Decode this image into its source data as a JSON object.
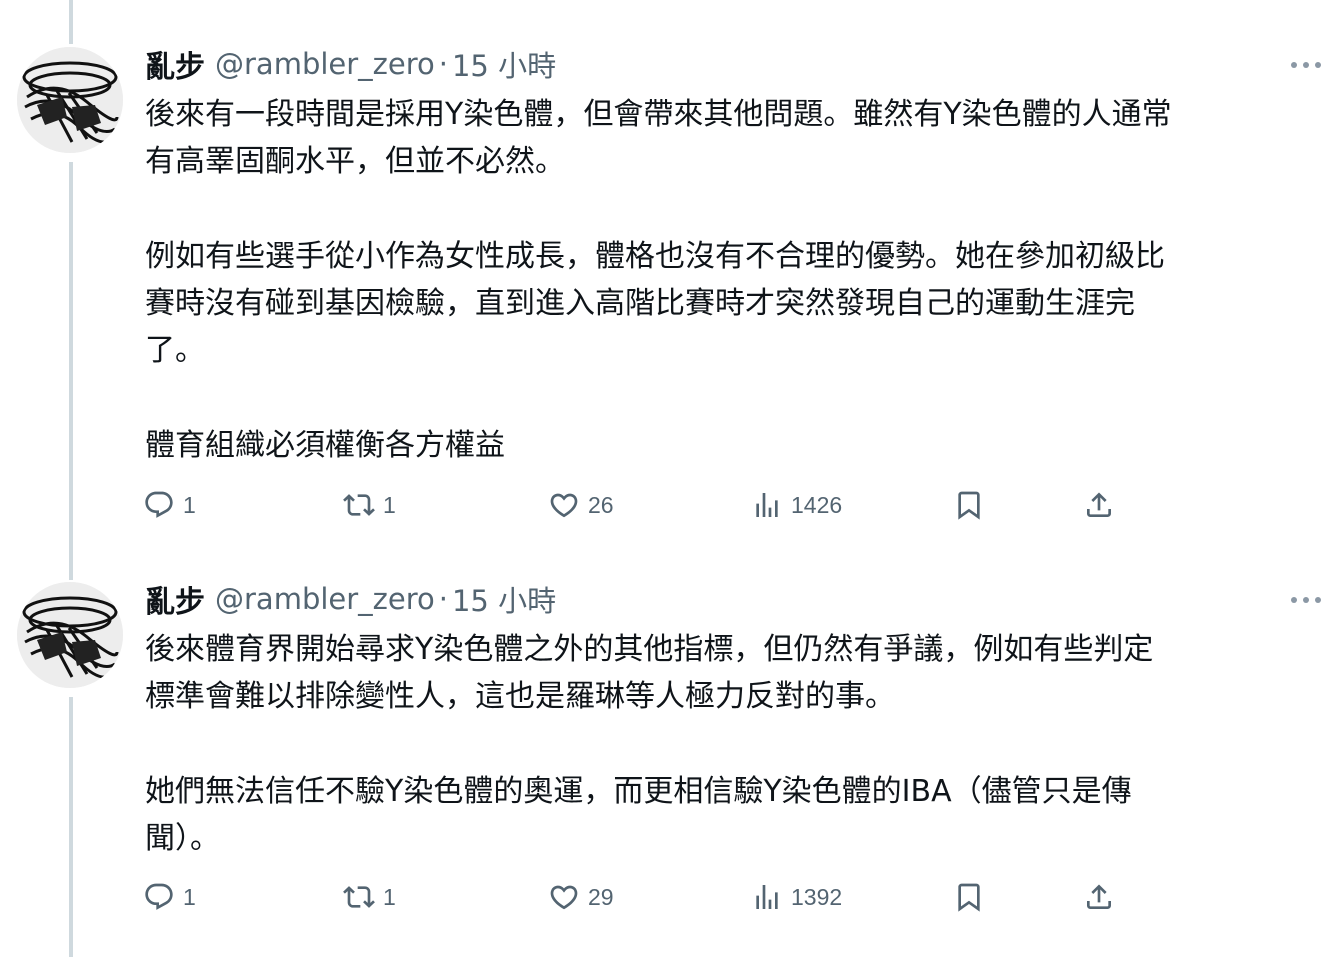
{
  "colors": {
    "text": "#0f1419",
    "secondary": "#536471",
    "thread_line": "#cfd9de"
  },
  "tweets": [
    {
      "name": "亂步",
      "handle": "@rambler_zero",
      "separator": "·",
      "time": "15 小時",
      "lines": [
        "後來有一段時間是採用Y染色體，但會帶來其他問題。雖然有Y染色體的人通常",
        "有高睪固酮水平，但並不必然。",
        "",
        "例如有些選手從小作為女性成長，體格也沒有不合理的優勢。她在參加初級比",
        "賽時沒有碰到基因檢驗，直到進入高階比賽時才突然發現自己的運動生涯完",
        "了。",
        "",
        "體育組織必須權衡各方權益"
      ],
      "replies": "1",
      "retweets": "1",
      "likes": "26",
      "views": "1426"
    },
    {
      "name": "亂步",
      "handle": "@rambler_zero",
      "separator": "·",
      "time": "15 小時",
      "lines": [
        "後來體育界開始尋求Y染色體之外的其他指標，但仍然有爭議，例如有些判定",
        "標準會難以排除變性人，這也是羅琳等人極力反對的事。",
        "",
        "她們無法信任不驗Y染色體的奧運，而更相信驗Y染色體的IBA（儘管只是傳",
        "聞）。"
      ],
      "replies": "1",
      "retweets": "1",
      "likes": "29",
      "views": "1392"
    }
  ],
  "icons": {
    "reply": "reply-icon",
    "retweet": "retweet-icon",
    "like": "heart-icon",
    "views": "views-chart-icon",
    "bookmark": "bookmark-icon",
    "share": "share-icon",
    "more": "more-dots-icon"
  }
}
